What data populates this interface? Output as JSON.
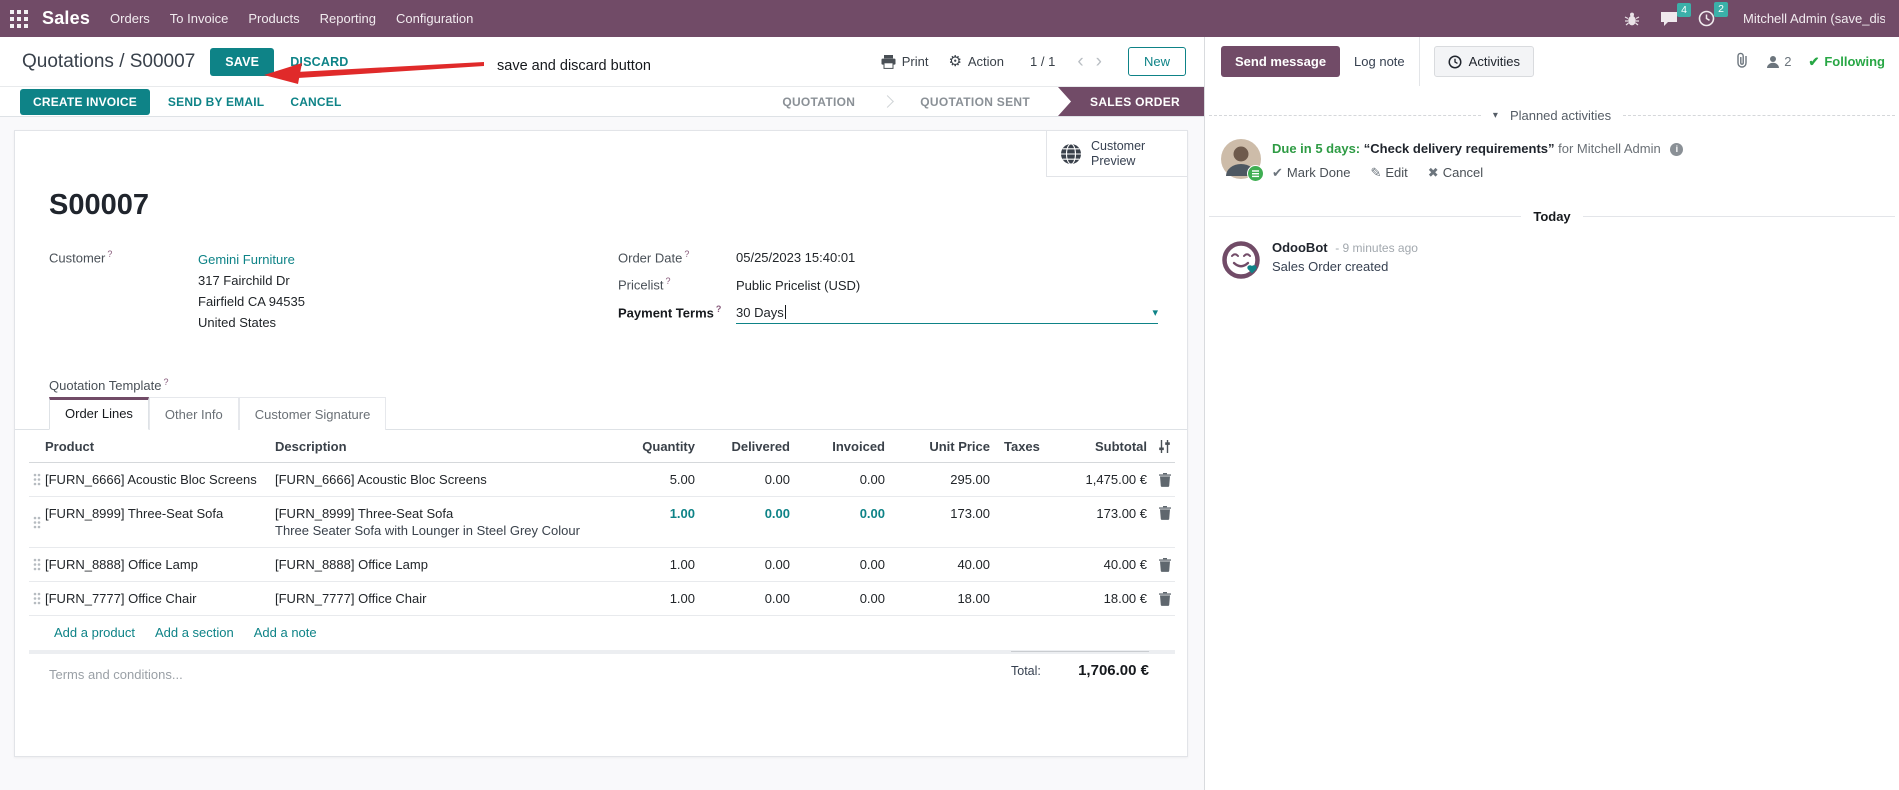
{
  "colors": {
    "brand": "#714B67",
    "accent": "#0e8387",
    "badge": "#3bb0a9",
    "success": "#28a745",
    "annotation_red": "#e02a2a"
  },
  "icons": {
    "help": "?",
    "dropdown": "▾",
    "prev": "‹",
    "next": "›",
    "check": "✔",
    "pencil": "✎",
    "cross": "✖",
    "info": "i",
    "gear": "⚙"
  },
  "navbar": {
    "app_name": "Sales",
    "menus": [
      "Orders",
      "To Invoice",
      "Products",
      "Reporting",
      "Configuration"
    ],
    "messages_badge": "4",
    "activities_badge": "2",
    "user_name": "Mitchell Admin (save_discar"
  },
  "control_panel": {
    "breadcrumb_parent": "Quotations",
    "breadcrumb_separator": "/",
    "breadcrumb_current": "S00007",
    "save": "SAVE",
    "discard": "DISCARD",
    "print": "Print",
    "action": "Action",
    "pager": "1 / 1",
    "new": "New"
  },
  "annotation": {
    "label": "save and discard button"
  },
  "statusbar": {
    "create_invoice": "CREATE INVOICE",
    "send_by_email": "SEND BY EMAIL",
    "cancel": "CANCEL",
    "states": [
      {
        "label": "QUOTATION"
      },
      {
        "label": "QUOTATION SENT"
      },
      {
        "label": "SALES ORDER",
        "active": true
      }
    ]
  },
  "sheet": {
    "customer_preview_line1": "Customer",
    "customer_preview_line2": "Preview",
    "title": "S00007",
    "customer_label": "Customer",
    "customer_name": "Gemini Furniture",
    "address_line1": "317 Fairchild Dr",
    "address_line2": "Fairfield CA 94535",
    "address_line3": "United States",
    "quotation_template_label": "Quotation Template",
    "order_date_label": "Order Date",
    "order_date_value": "05/25/2023 15:40:01",
    "pricelist_label": "Pricelist",
    "pricelist_value": "Public Pricelist (USD)",
    "payment_terms_label": "Payment Terms",
    "payment_terms_value": "30 Days",
    "tabs": [
      {
        "label": "Order Lines",
        "active": true
      },
      {
        "label": "Other Info"
      },
      {
        "label": "Customer Signature"
      }
    ],
    "columns": {
      "product": "Product",
      "description": "Description",
      "quantity": "Quantity",
      "delivered": "Delivered",
      "invoiced": "Invoiced",
      "unit_price": "Unit Price",
      "taxes": "Taxes",
      "subtotal": "Subtotal"
    },
    "rows": [
      {
        "product": "[FURN_6666] Acoustic Bloc Screens",
        "description": "[FURN_6666] Acoustic Bloc Screens",
        "description2": "",
        "quantity": "5.00",
        "delivered": "0.00",
        "invoiced": "0.00",
        "unit_price": "295.00",
        "taxes": "",
        "subtotal": "1,475.00 €"
      },
      {
        "product": "[FURN_8999] Three-Seat Sofa",
        "description": "[FURN_8999] Three-Seat Sofa",
        "description2": "Three Seater Sofa with Lounger in Steel Grey Colour",
        "quantity": "1.00",
        "delivered": "0.00",
        "invoiced": "0.00",
        "unit_price": "173.00",
        "taxes": "",
        "subtotal": "173.00 €"
      },
      {
        "product": "[FURN_8888] Office Lamp",
        "description": "[FURN_8888] Office Lamp",
        "description2": "",
        "quantity": "1.00",
        "delivered": "0.00",
        "invoiced": "0.00",
        "unit_price": "40.00",
        "taxes": "",
        "subtotal": "40.00 €"
      },
      {
        "product": "[FURN_7777] Office Chair",
        "description": "[FURN_7777] Office Chair",
        "description2": "",
        "quantity": "1.00",
        "delivered": "0.00",
        "invoiced": "0.00",
        "unit_price": "18.00",
        "taxes": "",
        "subtotal": "18.00 €"
      }
    ],
    "add_product": "Add a product",
    "add_section": "Add a section",
    "add_note": "Add a note",
    "terms_placeholder": "Terms and conditions...",
    "total_label": "Total:",
    "total_value": "1,706.00 €"
  },
  "chatter": {
    "send_message": "Send message",
    "log_note": "Log note",
    "activities": "Activities",
    "followers_count": "2",
    "following": "Following",
    "planned_activities": "Planned activities",
    "activity_due": "Due in 5 days:",
    "activity_summary": "“Check delivery requirements”",
    "activity_for": "for Mitchell Admin",
    "mark_done": "Mark Done",
    "edit": "Edit",
    "cancel": "Cancel",
    "today": "Today",
    "author": "OdooBot",
    "time": "- 9 minutes ago",
    "message": "Sales Order created"
  }
}
